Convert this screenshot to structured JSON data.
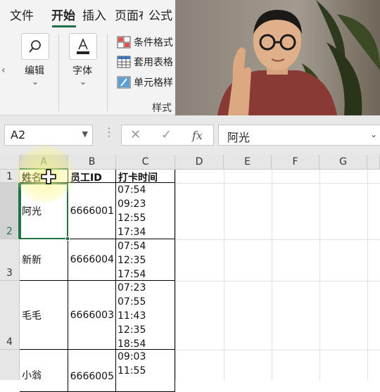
{
  "ribbon": {
    "tabs": [
      {
        "label": "文件"
      },
      {
        "label": "开始"
      },
      {
        "label": "插入"
      },
      {
        "label": "页面布"
      },
      {
        "label": "公式"
      }
    ],
    "find_label": "编辑",
    "font_label": "字体",
    "styles": {
      "conditional": "条件格式",
      "table": "套用表格",
      "cell": "单元格样",
      "group_label": "样式"
    }
  },
  "formula_bar": {
    "name_box": "A2",
    "formula": "阿光",
    "fx_symbol": "fx"
  },
  "columns": [
    "A",
    "B",
    "C",
    "D",
    "E",
    "F",
    "G"
  ],
  "rows": [
    "1",
    "2",
    "3",
    "4"
  ],
  "table": {
    "headers": {
      "name": "姓名",
      "id": "员工ID",
      "time": "打卡时间"
    },
    "rows": [
      {
        "name": "阿光",
        "id": "6666001",
        "times": [
          "07:54",
          "09:23",
          "12:55",
          "17:34"
        ]
      },
      {
        "name": "新新",
        "id": "6666004",
        "times": [
          "07:54",
          "12:35",
          "17:54"
        ]
      },
      {
        "name": "毛毛",
        "id": "6666003",
        "times": [
          "07:23",
          "07:55",
          "11:43",
          "12:35",
          "18:54"
        ]
      },
      {
        "name": "小翁",
        "id": "6666005",
        "times": [
          "09:03",
          "11:55"
        ]
      }
    ]
  },
  "colors": {
    "accent": "#217346"
  }
}
